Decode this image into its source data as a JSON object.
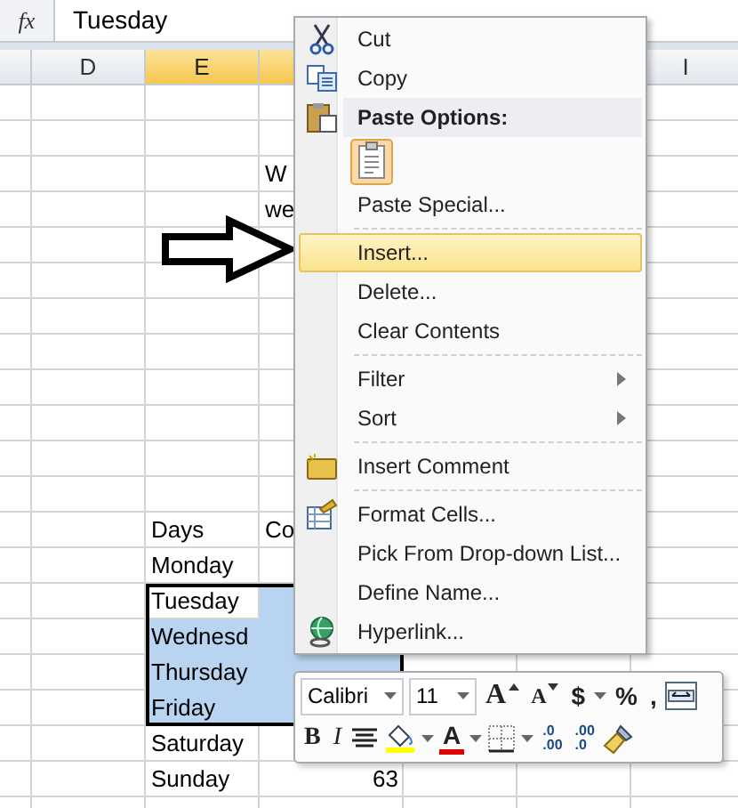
{
  "formula_bar": {
    "fx": "fx",
    "value": "Tuesday"
  },
  "columns": [
    {
      "label": "D",
      "selected": false
    },
    {
      "label": "E",
      "selected": true
    },
    {
      "selected": true
    },
    {
      "label": "I",
      "selected": false
    }
  ],
  "rows": [
    {
      "selected": false,
      "active": false
    },
    {
      "selected": false,
      "active": false
    },
    {
      "selected": false,
      "active": false,
      "f": "W",
      "f_numeric": false
    },
    {
      "selected": false,
      "active": false,
      "f": "we",
      "f_numeric": false
    },
    {
      "selected": false,
      "active": false
    },
    {
      "selected": false,
      "active": false
    },
    {
      "selected": false,
      "active": false
    },
    {
      "selected": false,
      "active": false
    },
    {
      "selected": false,
      "active": false
    },
    {
      "selected": false,
      "active": false
    },
    {
      "selected": false,
      "active": false
    },
    {
      "selected": false,
      "active": false
    },
    {
      "selected": false,
      "active": false,
      "e": "Days",
      "f": "Co",
      "f_numeric": false
    },
    {
      "selected": false,
      "active": false,
      "e": "Monday"
    },
    {
      "selected": true,
      "active": true,
      "e": "Tuesday"
    },
    {
      "selected": true,
      "active": false,
      "e": "Wednesd"
    },
    {
      "selected": true,
      "active": false,
      "e": "Thursday"
    },
    {
      "selected": true,
      "active": false,
      "e": "Friday"
    },
    {
      "selected": false,
      "active": false,
      "e": "Saturday"
    },
    {
      "selected": false,
      "active": false,
      "e": "Sunday",
      "f": "63",
      "f_numeric": true
    }
  ],
  "context_menu": {
    "items": [
      {
        "kind": "item",
        "label": "Cut",
        "selected": false,
        "submenu": false
      },
      {
        "kind": "item",
        "label": "Copy",
        "selected": false,
        "submenu": false
      },
      {
        "kind": "header",
        "label": "Paste Options:"
      },
      {
        "kind": "paste-options"
      },
      {
        "kind": "item",
        "label": "Paste Special...",
        "selected": false,
        "submenu": false
      },
      {
        "kind": "separator"
      },
      {
        "kind": "item",
        "label": "Insert...",
        "selected": true,
        "submenu": false
      },
      {
        "kind": "item",
        "label": "Delete...",
        "selected": false,
        "submenu": false
      },
      {
        "kind": "item",
        "label": "Clear Contents",
        "selected": false,
        "submenu": false
      },
      {
        "kind": "separator"
      },
      {
        "kind": "item",
        "label": "Filter",
        "selected": false,
        "submenu": true
      },
      {
        "kind": "item",
        "label": "Sort",
        "selected": false,
        "submenu": true
      },
      {
        "kind": "separator"
      },
      {
        "kind": "item",
        "label": "Insert Comment",
        "selected": false,
        "submenu": false
      },
      {
        "kind": "separator"
      },
      {
        "kind": "item",
        "label": "Format Cells...",
        "selected": false,
        "submenu": false
      },
      {
        "kind": "item",
        "label": "Pick From Drop-down List...",
        "selected": false,
        "submenu": false
      },
      {
        "kind": "item",
        "label": "Define Name...",
        "selected": false,
        "submenu": false
      },
      {
        "kind": "item",
        "label": "Hyperlink...",
        "selected": false,
        "submenu": false
      }
    ]
  },
  "mini_toolbar": {
    "top_controls": [
      {
        "kind": "dropdown",
        "label": "Calibri"
      },
      {
        "kind": "dropdown",
        "label": "11"
      },
      {
        "kind": "grow",
        "label": "A"
      },
      {
        "kind": "shrink",
        "label": "A"
      },
      {
        "kind": "text",
        "label": "$"
      },
      {
        "kind": "caret"
      },
      {
        "kind": "text",
        "label": "%"
      },
      {
        "kind": "text",
        "label": ","
      },
      {
        "kind": "merge"
      }
    ],
    "bottom_controls": [
      {
        "kind": "bold",
        "label": "B"
      },
      {
        "kind": "italic",
        "label": "I"
      },
      {
        "kind": "center"
      },
      {
        "kind": "fill"
      },
      {
        "kind": "caret"
      },
      {
        "kind": "fontcolor",
        "label": "A"
      },
      {
        "kind": "caret"
      },
      {
        "kind": "borders"
      },
      {
        "kind": "caret"
      },
      {
        "kind": "decimal",
        "top": ".0",
        "bottom": ".00"
      },
      {
        "kind": "decimal",
        "top": ".00",
        "bottom": ".0"
      },
      {
        "kind": "painter"
      }
    ]
  }
}
